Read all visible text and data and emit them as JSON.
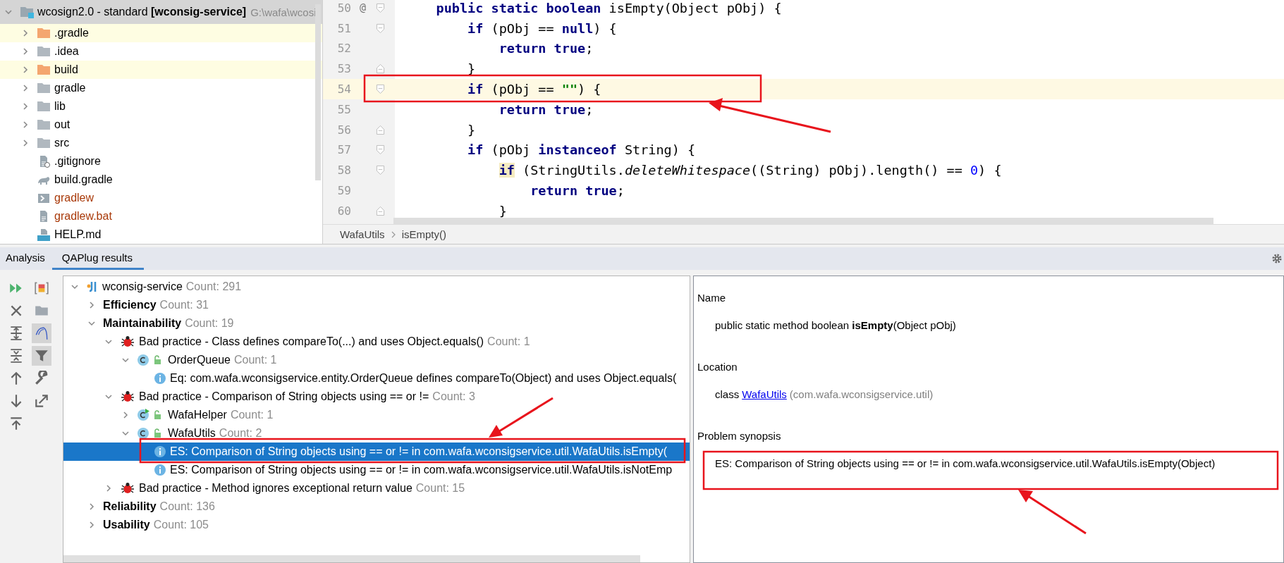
{
  "project": {
    "root": {
      "label": "wcosign2.0 - standard ",
      "module": "[wconsig-service]",
      "path": "G:\\wafa\\wcosi",
      "expanded": true,
      "selected": true
    },
    "items": [
      {
        "kind": "folder",
        "label": ".gradle",
        "excluded": true,
        "untracked": false,
        "expanded": false,
        "selected": false
      },
      {
        "kind": "folder",
        "label": ".idea",
        "excluded": false,
        "untracked": false,
        "expanded": false,
        "selected": false
      },
      {
        "kind": "folder",
        "label": "build",
        "excluded": true,
        "untracked": false,
        "expanded": false,
        "selected": false
      },
      {
        "kind": "folder",
        "label": "gradle",
        "excluded": false,
        "untracked": false,
        "expanded": false,
        "selected": false
      },
      {
        "kind": "folder",
        "label": "lib",
        "excluded": false,
        "untracked": false,
        "expanded": false,
        "selected": false
      },
      {
        "kind": "folder",
        "label": "out",
        "excluded": false,
        "untracked": false,
        "expanded": false,
        "selected": false
      },
      {
        "kind": "folder",
        "label": "src",
        "excluded": false,
        "untracked": false,
        "expanded": false,
        "selected": false
      },
      {
        "kind": "ignore",
        "label": ".gitignore",
        "excluded": false,
        "untracked": false,
        "selected": false
      },
      {
        "kind": "gradle",
        "label": "build.gradle",
        "excluded": false,
        "untracked": false,
        "selected": false
      },
      {
        "kind": "shell",
        "label": "gradlew",
        "excluded": false,
        "untracked": true,
        "selected": false
      },
      {
        "kind": "text",
        "label": "gradlew.bat",
        "excluded": false,
        "untracked": true,
        "selected": false
      },
      {
        "kind": "markdown",
        "label": "HELP.md",
        "excluded": false,
        "untracked": false,
        "selected": false
      }
    ]
  },
  "editor": {
    "lines": [
      {
        "number": "50",
        "marker": "@",
        "kind": "block-start",
        "current": false,
        "tokens": [
          {
            "kind": "kw",
            "text": "    public static boolean"
          },
          {
            "kind": "plain",
            "text": " isEmpty(Object pObj) {"
          }
        ]
      },
      {
        "number": "51",
        "kind": "block-start",
        "current": false,
        "tokens": [
          {
            "kind": "kw",
            "text": "        if"
          },
          {
            "kind": "plain",
            "text": " (pObj == "
          },
          {
            "kind": "kw",
            "text": "null"
          },
          {
            "kind": "plain",
            "text": ") {"
          }
        ]
      },
      {
        "number": "52",
        "kind": "plain",
        "current": false,
        "tokens": [
          {
            "kind": "kw",
            "text": "            return true"
          },
          {
            "kind": "plain",
            "text": ";"
          }
        ]
      },
      {
        "number": "53",
        "kind": "block-end",
        "current": false,
        "tokens": [
          {
            "kind": "plain",
            "text": "        }"
          }
        ]
      },
      {
        "number": "54",
        "kind": "block-start",
        "current": true,
        "tokens": [
          {
            "kind": "kw",
            "text": "        if"
          },
          {
            "kind": "plain",
            "text": " (pObj == "
          },
          {
            "kind": "str",
            "text": "\"\""
          },
          {
            "kind": "plain",
            "text": ") {"
          }
        ]
      },
      {
        "number": "55",
        "kind": "plain",
        "current": false,
        "tokens": [
          {
            "kind": "kw",
            "text": "            return true"
          },
          {
            "kind": "plain",
            "text": ";"
          }
        ]
      },
      {
        "number": "56",
        "kind": "block-end",
        "current": false,
        "tokens": [
          {
            "kind": "plain",
            "text": "        }"
          }
        ]
      },
      {
        "number": "57",
        "kind": "block-start",
        "current": false,
        "tokens": [
          {
            "kind": "kw",
            "text": "        if"
          },
          {
            "kind": "plain",
            "text": " (pObj "
          },
          {
            "kind": "kw",
            "text": "instanceof"
          },
          {
            "kind": "plain",
            "text": " String) {"
          }
        ]
      },
      {
        "number": "58",
        "kind": "block-start",
        "current": false,
        "tokens": [
          {
            "kind": "kw-hl",
            "text": "            if"
          },
          {
            "kind": "plain",
            "text": " (StringUtils."
          },
          {
            "kind": "italic",
            "text": "deleteWhitespace"
          },
          {
            "kind": "plain",
            "text": "((String) pObj).length() == "
          },
          {
            "kind": "num",
            "text": "0"
          },
          {
            "kind": "plain",
            "text": ") {"
          }
        ]
      },
      {
        "number": "59",
        "kind": "plain",
        "current": false,
        "tokens": [
          {
            "kind": "kw",
            "text": "                return true"
          },
          {
            "kind": "plain",
            "text": ";"
          }
        ]
      },
      {
        "number": "60",
        "kind": "block-end",
        "current": false,
        "tokens": [
          {
            "kind": "plain",
            "text": "            }"
          }
        ]
      }
    ],
    "breadcrumbs": [
      "WafaUtils",
      "isEmpty()"
    ]
  },
  "results": {
    "tabs": [
      {
        "label": "Analysis",
        "selected": false
      },
      {
        "label": "QAPlug results",
        "selected": true
      }
    ],
    "toolbar": [
      {
        "on": false
      },
      {
        "on": false
      },
      {
        "on": false
      },
      {
        "on": false
      },
      {
        "on": false
      },
      {
        "on": true
      },
      {
        "on": false
      },
      {
        "on": true
      },
      {
        "on": false
      },
      {
        "on": false
      },
      {
        "on": false
      },
      {
        "on": false
      },
      {
        "on": false
      }
    ],
    "tree": [
      {
        "kind": "module",
        "label": "wconsig-service",
        "count": "Count: 291",
        "expanded": true,
        "selected": false,
        "children": [
          {
            "kind": "category",
            "label": "Efficiency",
            "count": "Count: 31",
            "expanded": false,
            "selected": false
          },
          {
            "kind": "category",
            "label": "Maintainability",
            "count": "Count: 19",
            "expanded": true,
            "selected": false,
            "children": [
              {
                "kind": "bug",
                "label": "Bad practice - Class defines compareTo(...) and uses Object.equals()",
                "count": "Count: 1",
                "expanded": true,
                "selected": false,
                "children": [
                  {
                    "kind": "class",
                    "label": "OrderQueue",
                    "count": "Count: 1",
                    "expanded": true,
                    "selected": false,
                    "children": [
                      {
                        "kind": "issue",
                        "label": "Eq: com.wafa.wconsigservice.entity.OrderQueue defines compareTo(Object) and uses Object.equals(",
                        "selected": false
                      }
                    ]
                  }
                ]
              },
              {
                "kind": "bug",
                "label": "Bad practice - Comparison of String objects using == or !=",
                "count": "Count: 3",
                "expanded": true,
                "selected": false,
                "children": [
                  {
                    "kind": "runnable-class",
                    "label": "WafaHelper",
                    "count": "Count: 1",
                    "expanded": false,
                    "selected": false
                  },
                  {
                    "kind": "class",
                    "label": "WafaUtils",
                    "count": "Count: 2",
                    "expanded": true,
                    "selected": false,
                    "children": [
                      {
                        "kind": "issue",
                        "label": "ES: Comparison of String objects using == or != in com.wafa.wconsigservice.util.WafaUtils.isEmpty(",
                        "selected": true
                      },
                      {
                        "kind": "issue",
                        "label": "ES: Comparison of String objects using == or != in com.wafa.wconsigservice.util.WafaUtils.isNotEmp",
                        "selected": false
                      }
                    ]
                  }
                ]
              },
              {
                "kind": "bug",
                "label": "Bad practice - Method ignores exceptional return value",
                "count": "Count: 15",
                "expanded": false,
                "selected": false
              }
            ]
          },
          {
            "kind": "category",
            "label": "Reliability",
            "count": "Count: 136",
            "expanded": false,
            "selected": false
          },
          {
            "kind": "category",
            "label": "Usability",
            "count": "Count: 105",
            "expanded": false,
            "selected": false
          }
        ]
      }
    ],
    "details": [
      {
        "heading": "Name",
        "kind": "text",
        "text": "public static method boolean **isEmpty**(Object pObj)"
      },
      {
        "heading": "Location",
        "kind": "location",
        "prefix": "class",
        "link": "WafaUtils",
        "note": "(com.wafa.wconsigservice.util)"
      },
      {
        "heading": "Problem synopsis",
        "kind": "text",
        "text": "ES: Comparison of String objects using == or != in com.wafa.wconsigservice.util.WafaUtils.isEmpty(Object)"
      }
    ]
  }
}
